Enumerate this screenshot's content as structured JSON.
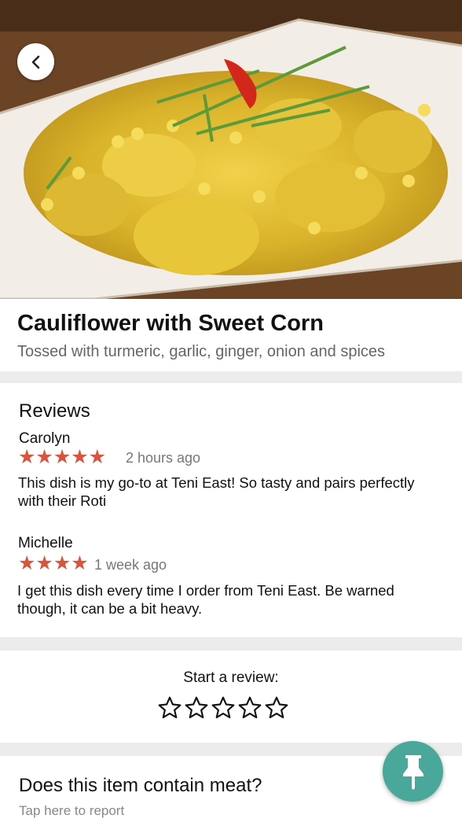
{
  "header": {
    "back_icon": "chevron-left-icon"
  },
  "dish": {
    "name": "Cauliflower with Sweet Corn",
    "description": "Tossed with turmeric, garlic, ginger, onion and spices"
  },
  "reviews": {
    "title": "Reviews",
    "items": [
      {
        "author": "Carolyn",
        "rating": 5,
        "stars": "★★★★★",
        "time": "2 hours ago",
        "text": "This dish is my go-to at Teni East! So tasty and pairs perfectly with their Roti"
      },
      {
        "author": "Michelle",
        "rating": 4,
        "stars": "★★★★",
        "time": "1 week ago",
        "text": "I get this dish every time I order from Teni East. Be warned though, it can be a bit heavy."
      }
    ]
  },
  "start_review": {
    "label": "Start a review:",
    "star_count": 5
  },
  "meat": {
    "title": "Does this item contain meat?",
    "subtitle": "Tap here to report"
  },
  "fab": {
    "icon": "pushpin-icon"
  },
  "colors": {
    "star": "#d9533d",
    "fab": "#4aa89a",
    "background": "#ececec"
  }
}
